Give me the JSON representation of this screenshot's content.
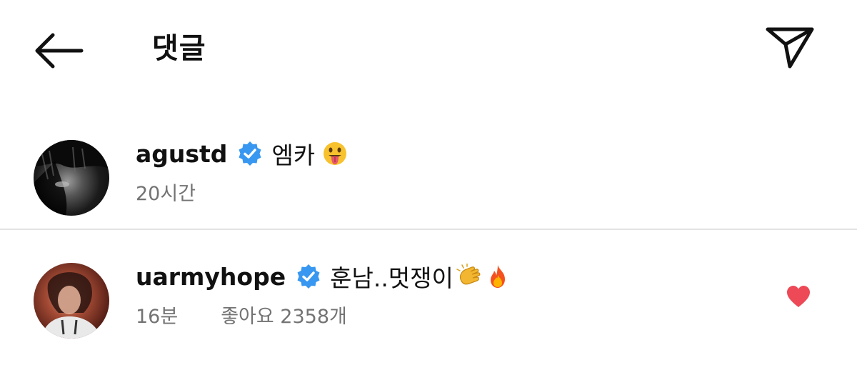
{
  "header": {
    "title": "댓글",
    "back_icon": "arrow-left-icon",
    "send_icon": "paper-plane-icon"
  },
  "comments": [
    {
      "username": "agustd",
      "verified": true,
      "text": "엠카",
      "emojis": [
        "face-with-tongue"
      ],
      "time": "20시간"
    },
    {
      "username": "uarmyhope",
      "verified": true,
      "text": "훈남..멋쟁이",
      "emojis": [
        "clapping-hands",
        "fire"
      ],
      "time": "16분",
      "likes": "좋아요 2358개",
      "liked": true
    }
  ],
  "colors": {
    "verified_blue": "#3897f0",
    "heart_red": "#ed4956",
    "meta_gray": "#737373",
    "divider": "#e3e3e3"
  }
}
